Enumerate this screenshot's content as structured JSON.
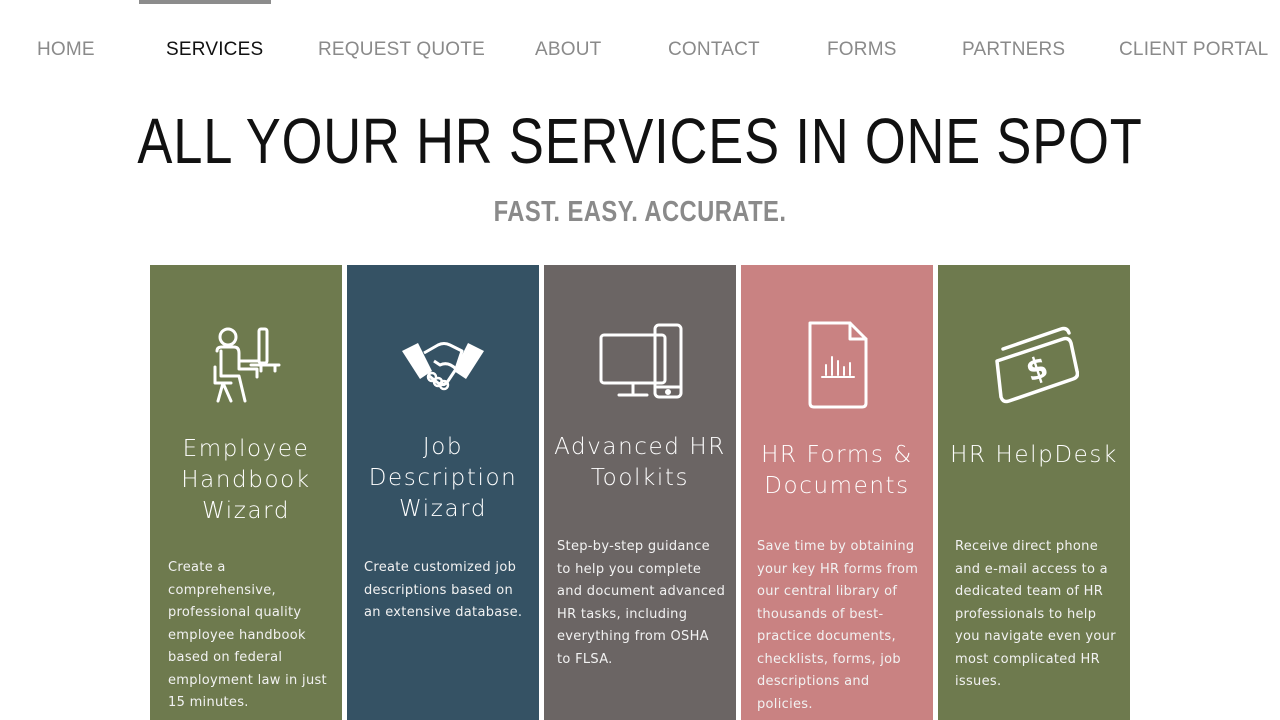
{
  "nav": {
    "items": [
      {
        "label": "HOME"
      },
      {
        "label": "SERVICES"
      },
      {
        "label": "REQUEST QUOTE"
      },
      {
        "label": "ABOUT"
      },
      {
        "label": "CONTACT"
      },
      {
        "label": "FORMS"
      },
      {
        "label": "PARTNERS"
      },
      {
        "label": "CLIENT PORTAL"
      }
    ],
    "active": "SERVICES"
  },
  "hero": {
    "title": "ALL YOUR HR SERVICES IN ONE SPOT",
    "subtitle": "FAST. EASY. ACCURATE."
  },
  "cards": [
    {
      "icon": "person-at-computer-icon",
      "color": "#6e7a4e",
      "title_lines": [
        "Employee",
        "Handbook",
        "Wizard"
      ],
      "description_lines": [
        "Create a",
        "comprehensive,",
        "professional quality",
        "employee handbook",
        "based on federal",
        "employment law in just",
        "15 minutes."
      ]
    },
    {
      "icon": "handshake-icon",
      "color": "#355264",
      "title_lines": [
        "Job",
        "Description",
        "Wizard"
      ],
      "description_lines": [
        "Create customized job",
        "descriptions based on",
        "an extensive database."
      ]
    },
    {
      "icon": "computer-devices-icon",
      "color": "#6b6564",
      "title_lines": [
        "Advanced HR",
        "Toolkits"
      ],
      "description_lines": [
        "Step-by-step guidance",
        "to help you complete",
        "and document advanced",
        "HR tasks, including",
        "everything from OSHA",
        "to FLSA."
      ]
    },
    {
      "icon": "document-chart-icon",
      "color": "#c98282",
      "title_lines": [
        "HR Forms &",
        "Documents"
      ],
      "description_lines": [
        "Save time by obtaining",
        "your key HR forms from",
        "our central library of",
        "thousands of best-",
        "practice documents,",
        "checklists, forms, job",
        "descriptions and",
        "policies."
      ]
    },
    {
      "icon": "money-bill-icon",
      "color": "#6e7a4e",
      "title_lines": [
        "HR HelpDesk"
      ],
      "description_lines": [
        "Receive direct phone",
        "and e-mail access to a",
        "dedicated team of HR",
        "professionals to help",
        "you navigate even your",
        "most complicated HR",
        "issues."
      ]
    }
  ]
}
